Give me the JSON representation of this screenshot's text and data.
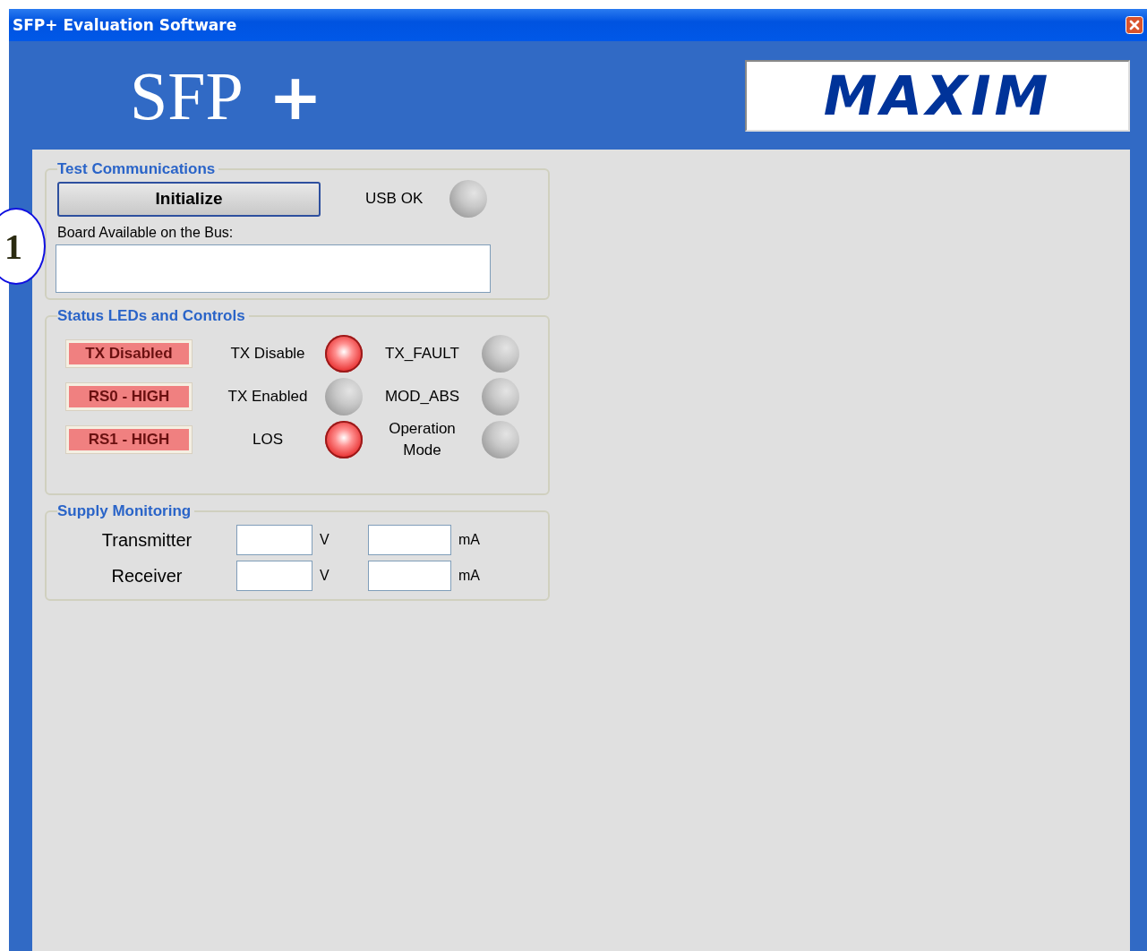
{
  "window": {
    "title": "SFP+ Evaluation Software"
  },
  "header": {
    "product_title": "SFP",
    "product_suffix": "+",
    "logo_text": "MAXIM"
  },
  "callout": {
    "number": "1"
  },
  "test_communications": {
    "title": "Test Communications",
    "button": "Initialize",
    "usb_led": {
      "label": "USB OK",
      "on": false
    },
    "board_label": "Board Available on the Bus:"
  },
  "status": {
    "title": "Status LEDs and Controls",
    "rows": [
      {
        "button": "TX Disabled",
        "left": {
          "label": "TX Disable",
          "on": true
        },
        "right": {
          "label": "TX_FAULT",
          "on": false
        }
      },
      {
        "button": "RS0 - HIGH",
        "left": {
          "label": "TX Enabled",
          "on": false
        },
        "right": {
          "label": "MOD_ABS",
          "on": false
        }
      },
      {
        "button": "RS1 - HIGH",
        "left": {
          "label": "LOS",
          "on": true
        },
        "right": {
          "label": "Operation Mode",
          "on": false
        }
      }
    ]
  },
  "supply": {
    "title": "Supply Monitoring",
    "rows": [
      {
        "label": "Transmitter",
        "voltage_unit": "V",
        "current_unit": "mA"
      },
      {
        "label": "Receiver",
        "voltage_unit": "V",
        "current_unit": "mA"
      }
    ]
  }
}
